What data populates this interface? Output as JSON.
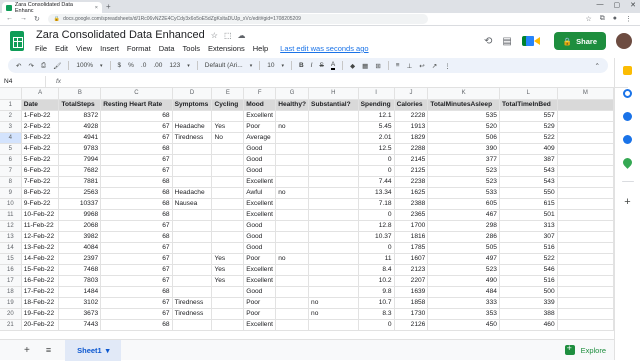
{
  "browser": {
    "tab_title": "Zara Consolidated Data Enhanc",
    "tab_close": "×",
    "new_tab": "+",
    "url": "docs.google.com/spreadsheets/d/1Rc06vNZ2E4CyCdy3x6o5oE5dZgKsltaDUJp_xVc/edit#gid=1708205209",
    "back": "←",
    "forward": "→",
    "reload": "↻",
    "win_min": "—",
    "win_max": "▢",
    "win_close": "✕"
  },
  "doc": {
    "title": "Zara Consolidated Data Enhanced",
    "star": "☆",
    "move": "⬚",
    "cloud": "☁",
    "menu": [
      "File",
      "Edit",
      "View",
      "Insert",
      "Format",
      "Data",
      "Tools",
      "Extensions",
      "Help"
    ],
    "last_edit": "Last edit was seconds ago",
    "history_icon": "⟲",
    "comment_icon": "▤",
    "share_label": "Share",
    "share_icon": "🔒"
  },
  "toolbar": {
    "undo": "↶",
    "redo": "↷",
    "print": "⎙",
    "paint": "🖌",
    "zoom": "100%",
    "currency": "$",
    "percent": "%",
    "dec_less": ".0",
    "dec_more": ".00",
    "more_formats": "123",
    "font": "Default (Ari...",
    "font_size": "10",
    "bold": "B",
    "italic": "I",
    "strike": "S",
    "text_color": "A",
    "fill": "◆",
    "borders": "▦",
    "merge": "⊞",
    "align": "≡",
    "valign": "⊥",
    "wrap": "↩",
    "rotate": "↗",
    "more": "⋮",
    "collapse": "⌃"
  },
  "formula_bar": {
    "cell_ref": "N4",
    "fx": "fx"
  },
  "columns": [
    "A",
    "B",
    "C",
    "D",
    "E",
    "F",
    "G",
    "H",
    "I",
    "J",
    "K",
    "L",
    "M"
  ],
  "headers": [
    "Date",
    "TotalSteps",
    "Resting Heart Rate",
    "Symptoms",
    "Cycling",
    "Mood",
    "Healthy?",
    "Substantial?",
    "Spending",
    "Calories",
    "TotalMinutesAsleep",
    "TotalTimeInBed",
    ""
  ],
  "rows": [
    [
      "1-Feb-22",
      "8372",
      "68",
      "",
      "",
      "Excellent",
      "",
      "",
      "12.1",
      "2228",
      "535",
      "557",
      ""
    ],
    [
      "2-Feb-22",
      "4928",
      "67",
      "Headache",
      "Yes",
      "Poor",
      "no",
      "",
      "5.45",
      "1913",
      "520",
      "529",
      ""
    ],
    [
      "3-Feb-22",
      "4941",
      "67",
      "Tiredness",
      "No",
      "Average",
      "",
      "",
      "2.01",
      "1829",
      "506",
      "522",
      ""
    ],
    [
      "4-Feb-22",
      "9783",
      "68",
      "",
      "",
      "Good",
      "",
      "",
      "12.5",
      "2288",
      "390",
      "409",
      ""
    ],
    [
      "5-Feb-22",
      "7994",
      "67",
      "",
      "",
      "Good",
      "",
      "",
      "0",
      "2145",
      "377",
      "387",
      ""
    ],
    [
      "6-Feb-22",
      "7682",
      "67",
      "",
      "",
      "Good",
      "",
      "",
      "0",
      "2125",
      "523",
      "543",
      ""
    ],
    [
      "7-Feb-22",
      "7881",
      "68",
      "",
      "",
      "Excellent",
      "",
      "",
      "7.44",
      "2238",
      "523",
      "543",
      ""
    ],
    [
      "8-Feb-22",
      "2563",
      "68",
      "Headache",
      "",
      "Awful",
      "no",
      "",
      "13.34",
      "1625",
      "533",
      "550",
      ""
    ],
    [
      "9-Feb-22",
      "10337",
      "68",
      "Nausea",
      "",
      "Excellent",
      "",
      "",
      "7.18",
      "2388",
      "605",
      "615",
      ""
    ],
    [
      "10-Feb-22",
      "9968",
      "68",
      "",
      "",
      "Excellent",
      "",
      "",
      "0",
      "2365",
      "467",
      "501",
      ""
    ],
    [
      "11-Feb-22",
      "2068",
      "67",
      "",
      "",
      "Good",
      "",
      "",
      "12.8",
      "1700",
      "298",
      "313",
      ""
    ],
    [
      "12-Feb-22",
      "3982",
      "68",
      "",
      "",
      "Good",
      "",
      "",
      "10.37",
      "1816",
      "286",
      "307",
      ""
    ],
    [
      "13-Feb-22",
      "4084",
      "67",
      "",
      "",
      "Good",
      "",
      "",
      "0",
      "1785",
      "505",
      "516",
      ""
    ],
    [
      "14-Feb-22",
      "2397",
      "67",
      "",
      "Yes",
      "Poor",
      "no",
      "",
      "11",
      "1607",
      "497",
      "522",
      ""
    ],
    [
      "15-Feb-22",
      "7468",
      "67",
      "",
      "Yes",
      "Excellent",
      "",
      "",
      "8.4",
      "2123",
      "523",
      "546",
      ""
    ],
    [
      "16-Feb-22",
      "7803",
      "67",
      "",
      "Yes",
      "Excellent",
      "",
      "",
      "10.2",
      "2207",
      "490",
      "516",
      ""
    ],
    [
      "17-Feb-22",
      "1484",
      "68",
      "",
      "",
      "Good",
      "",
      "",
      "9.8",
      "1639",
      "484",
      "500",
      ""
    ],
    [
      "18-Feb-22",
      "3102",
      "67",
      "Tiredness",
      "",
      "Poor",
      "",
      "no",
      "10.7",
      "1858",
      "333",
      "339",
      ""
    ],
    [
      "19-Feb-22",
      "3673",
      "67",
      "Tiredness",
      "",
      "Poor",
      "",
      "no",
      "8.3",
      "1730",
      "353",
      "388",
      ""
    ],
    [
      "20-Feb-22",
      "7443",
      "68",
      "",
      "",
      "Excellent",
      "",
      "",
      "0",
      "2126",
      "450",
      "460",
      ""
    ]
  ],
  "bottom": {
    "add": "+",
    "all_sheets": "≡",
    "sheet_name": "Sheet1",
    "sheet_caret": "▾",
    "explore": "Explore"
  }
}
